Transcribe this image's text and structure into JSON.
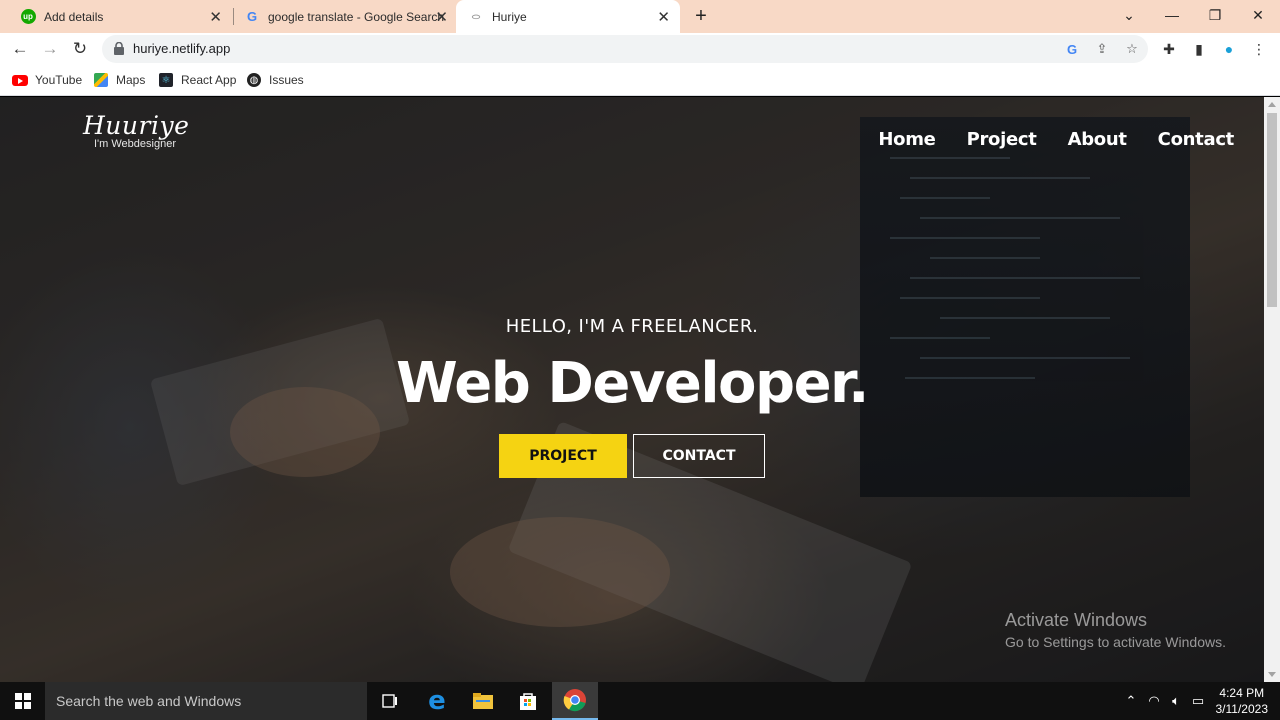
{
  "browser": {
    "tabs": [
      {
        "title": "Add details",
        "icon": "upwork-icon"
      },
      {
        "title": "google translate - Google Search",
        "icon": "google-icon"
      },
      {
        "title": "Huriye",
        "icon": "page-icon"
      }
    ],
    "url": "huriye.netlify.app",
    "bookmarks": [
      {
        "label": "YouTube",
        "icon": "youtube-icon"
      },
      {
        "label": "Maps",
        "icon": "maps-icon"
      },
      {
        "label": "React App",
        "icon": "react-icon"
      },
      {
        "label": "Issues",
        "icon": "globe-icon"
      }
    ]
  },
  "site": {
    "logo_name": "Huuriye",
    "logo_sub": "I'm Webdesigner",
    "nav": [
      "Home",
      "Project",
      "About",
      "Contact"
    ],
    "hero_sub": "HELLO, I'M A FREELANCER.",
    "hero_title": "Web Developer.",
    "btn_project": "PROJECT",
    "btn_contact": "CONTACT",
    "accent_color": "#f5d312"
  },
  "watermark": {
    "line1": "Activate Windows",
    "line2": "Go to Settings to activate Windows."
  },
  "taskbar": {
    "search_placeholder": "Search the web and Windows",
    "time": "4:24 PM",
    "date": "3/11/2023"
  }
}
